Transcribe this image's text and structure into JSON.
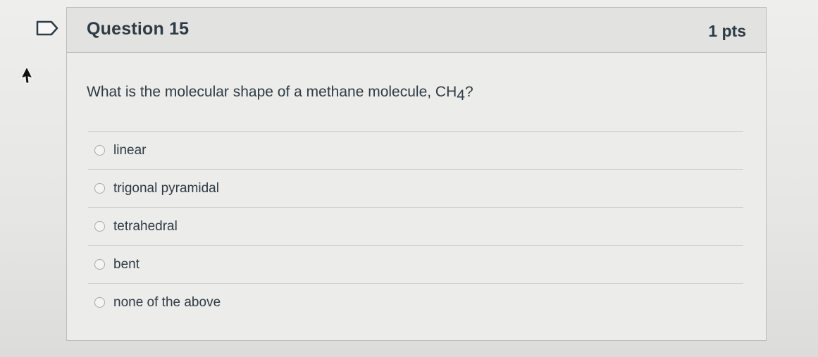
{
  "question": {
    "title": "Question 15",
    "points": "1 pts",
    "text_main": "What is the molecular shape of a methane molecule, CH",
    "text_subscript": "4",
    "text_end": "?"
  },
  "answers": [
    {
      "label": "linear"
    },
    {
      "label": "trigonal pyramidal"
    },
    {
      "label": "tetrahedral"
    },
    {
      "label": "bent"
    },
    {
      "label": "none of the above"
    }
  ],
  "icons": {
    "flag": "bookmark-flag-icon",
    "cursor": "mouse-pointer-icon"
  },
  "colors": {
    "text": "#2d3b45",
    "accent": "#2d3b45"
  }
}
